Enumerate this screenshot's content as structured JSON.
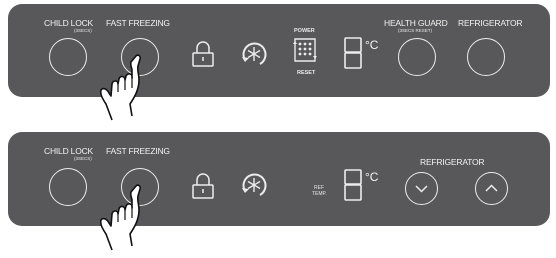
{
  "panel_top": {
    "child_lock": {
      "label": "CHILD LOCK",
      "sub": "(3SECS)"
    },
    "fast_freezing": {
      "label": "FAST FREEZING"
    },
    "power": {
      "label": "POWER",
      "reset_label": "RESET"
    },
    "temp_unit": "°C",
    "health_guard": {
      "label": "HEALTH GUARD",
      "sub": "(3SECS RESET)"
    },
    "refrigerator": {
      "label": "REFRIGERATOR"
    }
  },
  "panel_bottom": {
    "child_lock": {
      "label": "CHILD LOCK",
      "sub": "(3SECS)"
    },
    "fast_freezing": {
      "label": "FAST FREEZING"
    },
    "ref_temp": {
      "line1": "REF",
      "line2": "TEMP."
    },
    "temp_unit": "°C",
    "refrigerator": {
      "label": "REFRIGERATOR"
    }
  },
  "icons": {
    "lock": "lock-icon",
    "fast_freeze": "snowflake-cycle-icon",
    "power": "power-filter-icon",
    "display": "seven-segment-display",
    "down": "chevron-down-icon",
    "up": "chevron-up-icon",
    "hand": "pointing-hand-icon"
  },
  "colors": {
    "panel": "#58585a",
    "line": "#ececec"
  }
}
